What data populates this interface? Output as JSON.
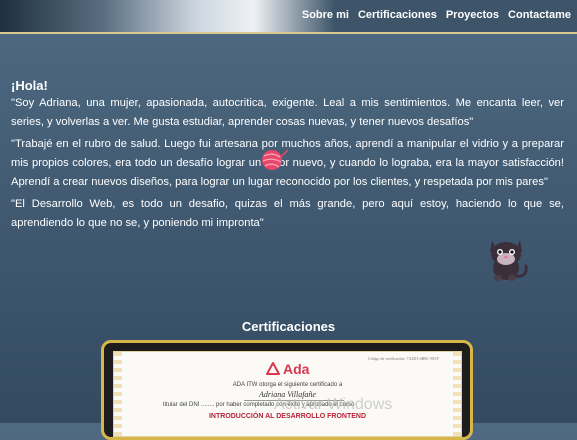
{
  "header": {
    "nav": [
      {
        "label": "Sobre mi"
      },
      {
        "label": "Certificaciones"
      },
      {
        "label": "Proyectos"
      },
      {
        "label": "Contactame"
      }
    ]
  },
  "about": {
    "greeting": "¡Hola!",
    "paragraphs": [
      "\"Soy Adriana, una mujer, apasionada, autocritica, exigente. Leal a mis sentimientos. Me encanta leer, ver series, y volverlas a ver. Me gusta estudiar, aprender cosas nuevas, y tener nuevos desafíos\"",
      "\"Trabajé en el rubro de salud. Luego fui artesana por muchos años, aprendí a manipular el vidrio y a preparar mis propios colores, era todo un desafío lograr un color nuevo, y cuando lo lograba, era la mayor satisfacción! Aprendí a crear nuevos diseños, para lograr un lugar reconocido por los clientes, y respetada por mis pares\"",
      "\"El Desarrollo Web, es todo un desafio, quizas el más grande, pero aquí estoy, haciendo lo que se, aprendiendo lo que no se, y poniendo mi impronta\""
    ]
  },
  "certifications": {
    "title": "Certificaciones",
    "certificate": {
      "code": "Código de verificación: 7A2D3-4B8C-9E1F",
      "logo_text": "Ada",
      "line1": "ADA ITW otorga el siguiente certificado a",
      "name": "Adriana Villafañe",
      "line2": "titular del DNI  ........  por haber completado con éxito y aprobado el curso",
      "course": "INTRODUCCIÓN AL DESARROLLO FRONTEND"
    }
  },
  "os_overlay": {
    "watermark": "Activar Windows"
  },
  "colors": {
    "background": "#435d75",
    "header_border": "#d9c88a",
    "frame_gold": "#d8b74a",
    "ada_red": "#d8384e",
    "yarn_pink": "#e8466b"
  },
  "icons": {
    "yarn": "yarn-ball-icon",
    "cat": "cat-icon",
    "ada_logo": "ada-logo-icon"
  }
}
